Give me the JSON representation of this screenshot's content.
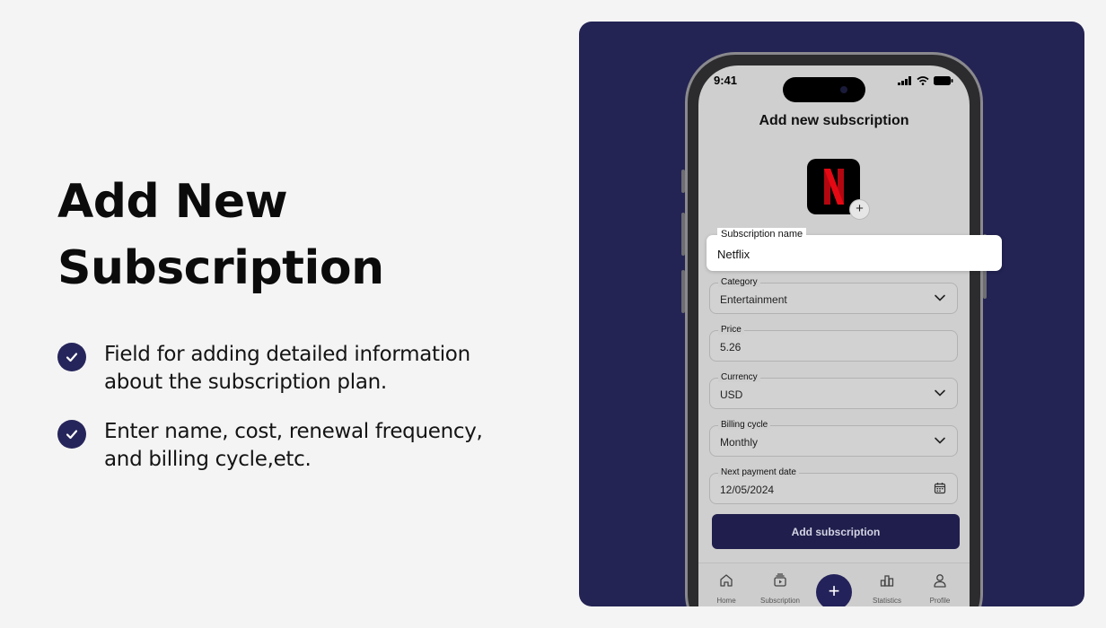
{
  "left": {
    "headline_line1": "Add New",
    "headline_line2": "Subscription",
    "features": [
      {
        "line1": "Field for adding detailed information",
        "line2": "about the subscription plan."
      },
      {
        "line1": "Enter name, cost, renewal frequency,",
        "line2": "and billing cycle,etc."
      }
    ]
  },
  "phone": {
    "status_time": "9:41",
    "title": "Add new subscription",
    "app_icon_letter": "N",
    "app_icon_plus": "+",
    "subscription_name": {
      "label": "Subscription name",
      "value": "Netflix"
    },
    "category": {
      "label": "Category",
      "value": "Entertainment"
    },
    "price": {
      "label": "Price",
      "value": "5.26"
    },
    "currency": {
      "label": "Currency",
      "value": "USD"
    },
    "billing_cycle": {
      "label": "Billing cycle",
      "value": "Monthly"
    },
    "next_payment": {
      "label": "Next payment date",
      "value": "12/05/2024"
    },
    "submit_label": "Add subscription",
    "tabs": {
      "home": "Home",
      "subscription": "Subscription",
      "add": "+",
      "statistics": "Statistics",
      "profile": "Profile"
    }
  },
  "colors": {
    "accent": "#26255b",
    "panel_bg": "#232354",
    "netflix_red": "#e50914"
  }
}
